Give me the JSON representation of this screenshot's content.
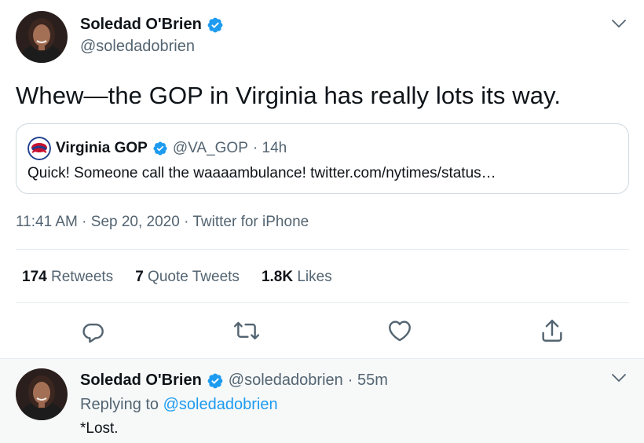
{
  "colors": {
    "accent": "#1d9bf0",
    "text": "#0f1419",
    "muted": "#536471",
    "border": "#cfd9de",
    "reply_bg": "#f7f9f9"
  },
  "tweet": {
    "author_name": "Soledad O'Brien",
    "author_handle": "@soledadobrien",
    "text": "Whew—the GOP in Virginia has really lots its way.",
    "quote": {
      "name": "Virginia GOP",
      "handle": "@VA_GOP",
      "time": "· 14h",
      "text": "Quick! Someone call the waaaambulance! twitter.com/nytimes/status…"
    },
    "time": "11:41 AM",
    "date": "Sep 20, 2020",
    "source": "Twitter for iPhone",
    "sep": "·",
    "stats": {
      "retweets_count": "174",
      "retweets_label": "Retweets",
      "quotes_count": "7",
      "quotes_label": "Quote Tweets",
      "likes_count": "1.8K",
      "likes_label": "Likes"
    },
    "icons": [
      "reply-icon",
      "retweet-icon",
      "like-icon",
      "share-icon"
    ]
  },
  "reply": {
    "author_name": "Soledad O'Brien",
    "author_handle": "@soledadobrien",
    "time": "· 55m",
    "replying_prefix": "Replying to",
    "replying_to": "@soledadobrien",
    "text": "*Lost."
  }
}
